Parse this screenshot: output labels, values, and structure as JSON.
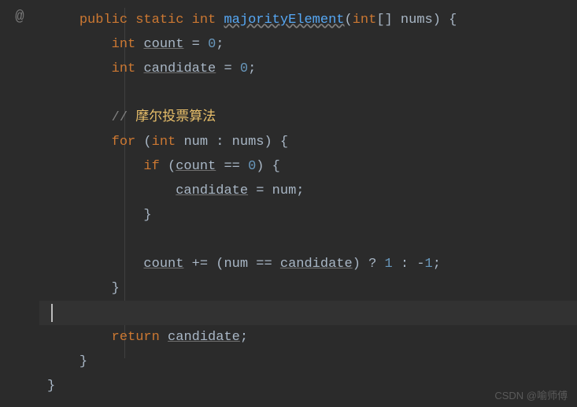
{
  "gutter": {
    "icon": "@"
  },
  "code": {
    "l1": {
      "kw1": "public",
      "kw2": "static",
      "kw3": "int",
      "method": "majorityElement",
      "paren1": "(",
      "kw4": "int",
      "arr": "[] ",
      "param": "nums",
      "paren2": ")",
      "brace": " {"
    },
    "l2": {
      "kw": "int",
      "var": "count",
      "eq": " = ",
      "num": "0",
      "semi": ";"
    },
    "l3": {
      "kw": "int",
      "var": "candidate",
      "eq": " = ",
      "num": "0",
      "semi": ";"
    },
    "l4": {
      "slash": "//",
      "text": " 摩尔投票算法"
    },
    "l5": {
      "kw1": "for",
      "paren1": " (",
      "kw2": "int",
      "var": " num ",
      "colon": ": ",
      "iter": "nums",
      "paren2": ")",
      "brace": " {"
    },
    "l6": {
      "kw": "if",
      "paren1": " (",
      "var": "count",
      "eq": " == ",
      "num": "0",
      "paren2": ")",
      "brace": " {"
    },
    "l7": {
      "var": "candidate",
      "eq": " = ",
      "rhs": "num",
      "semi": ";"
    },
    "l8": {
      "brace": "}"
    },
    "l9": {
      "var": "count",
      "op": " += (",
      "lhs": "num",
      "eq": " == ",
      "rhs": "candidate",
      "paren": ")",
      "tern": " ? ",
      "n1": "1",
      "colon": " : ",
      "neg": "-",
      "n2": "1",
      "semi": ";"
    },
    "l10": {
      "brace": "}"
    },
    "l11": {
      "kw": "return",
      "sp": " ",
      "var": "candidate",
      "semi": ";"
    },
    "l12": {
      "brace": "}"
    },
    "l13": {
      "brace": "}"
    }
  },
  "watermark": "CSDN @喻师傅"
}
